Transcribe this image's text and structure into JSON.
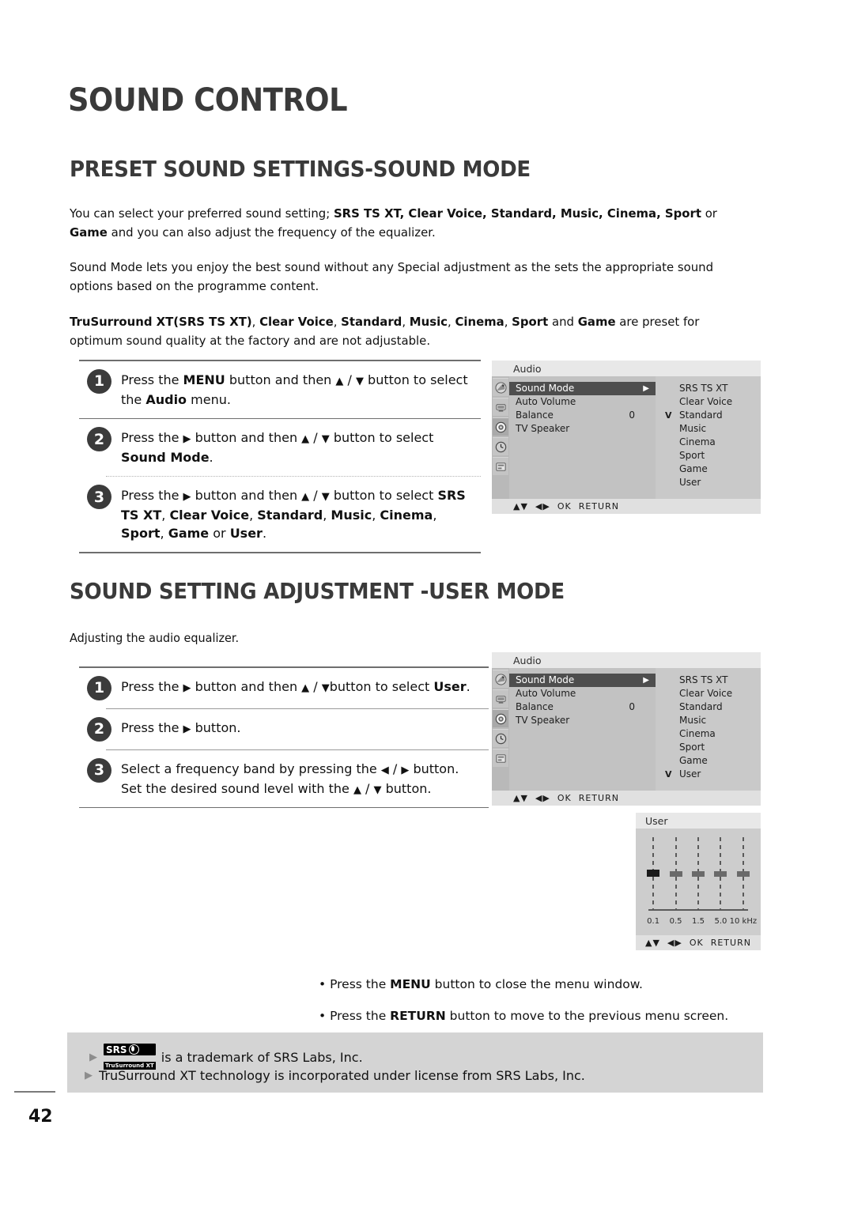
{
  "chapter_title": "SOUND CONTROL",
  "sections": [
    {
      "title": "PRESET SOUND SETTINGS-SOUND MODE",
      "paragraphs": [
        "You can select your preferred sound setting; <b>SRS TS XT, Clear Voice, Standard, Music, Cinema, Sport</b> or <b>Game</b> and you can also adjust the  frequency of the equalizer.",
        "Sound Mode lets you enjoy the best sound without any Special adjustment as the sets the appropriate sound options based on the programme content.",
        "<b>TruSurround XT(SRS TS XT)</b>, <b>Clear Voice</b>, <b>Standard</b>, <b>Music</b>, <b>Cinema</b>, <b>Sport</b> and <b>Game</b> are preset for optimum sound quality at the factory and are not adjustable."
      ],
      "steps": [
        {
          "number": "1",
          "html": "Press the <b>MENU</b> button and then <span class=\"glyph\">▲</span> / <span class=\"glyph\">▼</span> button to select the <b>Audio</b> menu."
        },
        {
          "number": "2",
          "html": "Press the <span class=\"glyph\">▶</span> button and then <span class=\"glyph\">▲</span> / <span class=\"glyph\">▼</span>  button to select <b>Sound Mode</b>."
        },
        {
          "number": "3",
          "html": "Press the <span class=\"glyph\">▶</span> button and then <span class=\"glyph\">▲</span> / <span class=\"glyph\">▼</span> button to select <b>SRS TS XT</b>, <b>Clear Voice</b>, <b>Standard</b>, <b>Music</b>, <b>Cinema</b>, <b>Sport</b>, <b>Game</b> or <b>User</b>."
        }
      ]
    },
    {
      "title": "SOUND SETTING ADJUSTMENT -USER MODE",
      "intro": "Adjusting the audio equalizer.",
      "steps": [
        {
          "number": "1",
          "html": "Press the <span class=\"glyph\">▶</span> button and then <span class=\"glyph\">▲</span> / <span class=\"glyph\">▼</span>button to select <b>User</b>."
        },
        {
          "number": "2",
          "html": "Press the <span class=\"glyph\">▶</span> button."
        },
        {
          "number": "3",
          "html": "Select a frequency band by pressing the <span class=\"glyph\">◀</span> / <span class=\"glyph\">▶</span> button.<br>Set the desired sound level with the <span class=\"glyph\">▲</span> / <span class=\"glyph\">▼</span> button."
        }
      ]
    }
  ],
  "osd_menu_1": {
    "title": "Audio",
    "rail_icons": [
      "satellite-dish-icon",
      "picture-tv-icon",
      "audio-disc-icon",
      "clock-icon",
      "setup-icon"
    ],
    "rail_active_index": 2,
    "rows": [
      {
        "label": "Sound Mode",
        "value": "",
        "arrow": "▶",
        "selected": true
      },
      {
        "label": "Auto Volume",
        "value": "",
        "arrow": "",
        "selected": false
      },
      {
        "label": "Balance",
        "value": "0",
        "arrow": "",
        "selected": false
      },
      {
        "label": "TV Speaker",
        "value": "",
        "arrow": "",
        "selected": false
      }
    ],
    "options": [
      {
        "label": "SRS TS XT",
        "checked": false
      },
      {
        "label": "Clear Voice",
        "checked": false
      },
      {
        "label": "Standard",
        "checked": true
      },
      {
        "label": "Music",
        "checked": false
      },
      {
        "label": "Cinema",
        "checked": false
      },
      {
        "label": "Sport",
        "checked": false
      },
      {
        "label": "Game",
        "checked": false
      },
      {
        "label": "User",
        "checked": false
      }
    ],
    "footer": [
      "▲▼",
      "◀▶",
      "OK",
      "RETURN"
    ]
  },
  "osd_menu_2": {
    "title": "Audio",
    "rail_icons": [
      "satellite-dish-icon",
      "picture-tv-icon",
      "audio-disc-icon",
      "clock-icon",
      "setup-icon"
    ],
    "rail_active_index": 2,
    "rows": [
      {
        "label": "Sound Mode",
        "value": "",
        "arrow": "▶",
        "selected": true
      },
      {
        "label": "Auto Volume",
        "value": "",
        "arrow": "",
        "selected": false
      },
      {
        "label": "Balance",
        "value": "0",
        "arrow": "",
        "selected": false
      },
      {
        "label": "TV Speaker",
        "value": "",
        "arrow": "",
        "selected": false
      }
    ],
    "options": [
      {
        "label": "SRS TS XT",
        "checked": false
      },
      {
        "label": "Clear Voice",
        "checked": false
      },
      {
        "label": "Standard",
        "checked": false
      },
      {
        "label": "Music",
        "checked": false
      },
      {
        "label": "Cinema",
        "checked": false
      },
      {
        "label": "Sport",
        "checked": false
      },
      {
        "label": "Game",
        "checked": false
      },
      {
        "label": "User",
        "checked": true
      }
    ],
    "footer": [
      "▲▼",
      "◀▶",
      "OK",
      "RETURN"
    ]
  },
  "osd_equalizer": {
    "title": "User",
    "bands": [
      {
        "label": "0.1",
        "level": 0,
        "selected": true
      },
      {
        "label": "0.5",
        "level": 0,
        "selected": false
      },
      {
        "label": "1.5",
        "level": 0,
        "selected": false
      },
      {
        "label": "5.0",
        "level": 0,
        "selected": false
      },
      {
        "label": "10 kHz",
        "level": 0,
        "selected": false
      }
    ],
    "footer": [
      "▲▼",
      "◀▶",
      "OK",
      "RETURN"
    ]
  },
  "notes": [
    "• Press the <b>MENU</b> button to close the menu window.",
    "• Press the <b>RETURN</b> button to move to the previous menu screen."
  ],
  "trademark": {
    "logo_primary": "SRS",
    "logo_secondary": "TruSurround XT",
    "line_1_text": "is a trademark of SRS Labs, Inc.",
    "line_2_text": "TruSurround XT technology is incorporated under license from SRS Labs, Inc."
  },
  "page_number": "42",
  "colors": {
    "heading": "#3a3a3a",
    "badge": "#3b3b3b",
    "osd_bg": "#cccccc",
    "osd_selected": "#4e4e4e",
    "trademark_bg": "#d4d4d4"
  }
}
